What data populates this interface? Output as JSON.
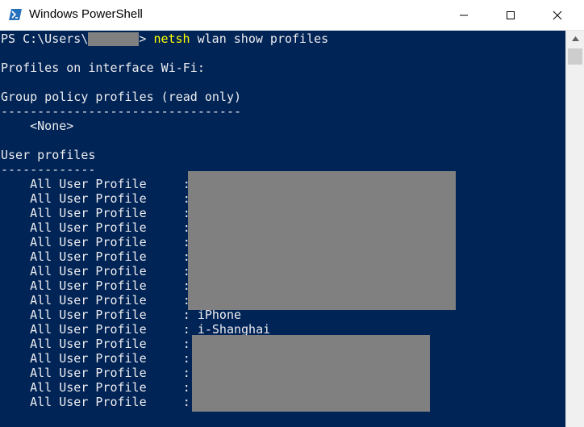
{
  "window": {
    "title": "Windows PowerShell",
    "icon": "powershell-icon",
    "controls": {
      "minimize": "minimize-icon",
      "maximize": "maximize-icon",
      "close": "close-icon"
    }
  },
  "colors": {
    "console_background": "#012456",
    "console_text": "#eeedf0",
    "command_text": "#ffff00",
    "redaction": "#808080"
  },
  "console": {
    "prompt_prefix": "PS C:\\Users\\",
    "prompt_suffix": "> ",
    "command": "netsh",
    "command_args": " wlan show profiles",
    "interface_line": "Profiles on interface Wi-Fi:",
    "group_policy_header": "Group policy profiles (read only)",
    "group_policy_underline": "---------------------------------",
    "group_policy_none": "    <None>",
    "user_profiles_header": "User profiles",
    "user_profiles_underline": "-------------",
    "profile_label": "    All User Profile     :",
    "visible_profiles": [
      "iPhone",
      "i-Shanghai"
    ]
  }
}
